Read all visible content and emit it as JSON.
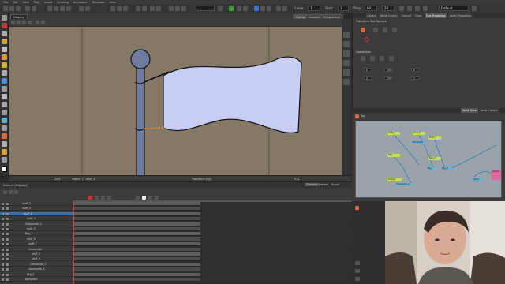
{
  "menubar": {
    "items": [
      "File",
      "Edit",
      "View",
      "Play",
      "Insert",
      "Drawing",
      "Animation",
      "Windows",
      "Help"
    ]
  },
  "toolbar": {
    "frame_label": "Frame",
    "frame_value": "1",
    "start_label": "Start",
    "start_value": "1",
    "stop_label": "Stop",
    "stop_value": "60",
    "fps_value": "24",
    "workspace_value": "Default"
  },
  "view": {
    "display_value": "Display",
    "tabs": [
      "Camera",
      "Drawing",
      "Perspective"
    ],
    "zoom": "32%",
    "status_frame": "Frame: 1",
    "drawing_name": "stuff_1",
    "status_mode": "Transform (All)",
    "status_coords": "911"
  },
  "right_panel": {
    "tabs": [
      "Library",
      "Node Library",
      "Control",
      "Color",
      "Tool Properties",
      "Layer Properties"
    ],
    "section1": "Transform Tool Options",
    "section2": "Operations",
    "fields": [
      "0",
      "0",
      "100",
      "100",
      "0",
      "0"
    ]
  },
  "node_view": {
    "tabs": [
      "Node View",
      "Node Library"
    ],
    "breadcrumb": "Top",
    "nodes": [
      "stuff_2",
      "stuff_3",
      "stuff_1",
      "Composite",
      "flag",
      "flag_2",
      "Peg",
      "Peg_2",
      "Display",
      "Composite_2",
      "Write",
      "Comp"
    ]
  },
  "timeline": {
    "title": "Default (Display)",
    "tabs": [
      "Timeline",
      "Xsheet",
      "Script"
    ],
    "layers": [
      "stuff_2",
      "stuff_3",
      "stuff_1",
      "stuff_4",
      "Composite_4",
      "stuff_5",
      "Peg_3",
      "stuff_6",
      "stuff_7",
      "Composite",
      "stuff_8",
      "stuff_9",
      "Composite_3",
      "Composite_5",
      "Peg_4",
      "Ball/wave"
    ]
  }
}
